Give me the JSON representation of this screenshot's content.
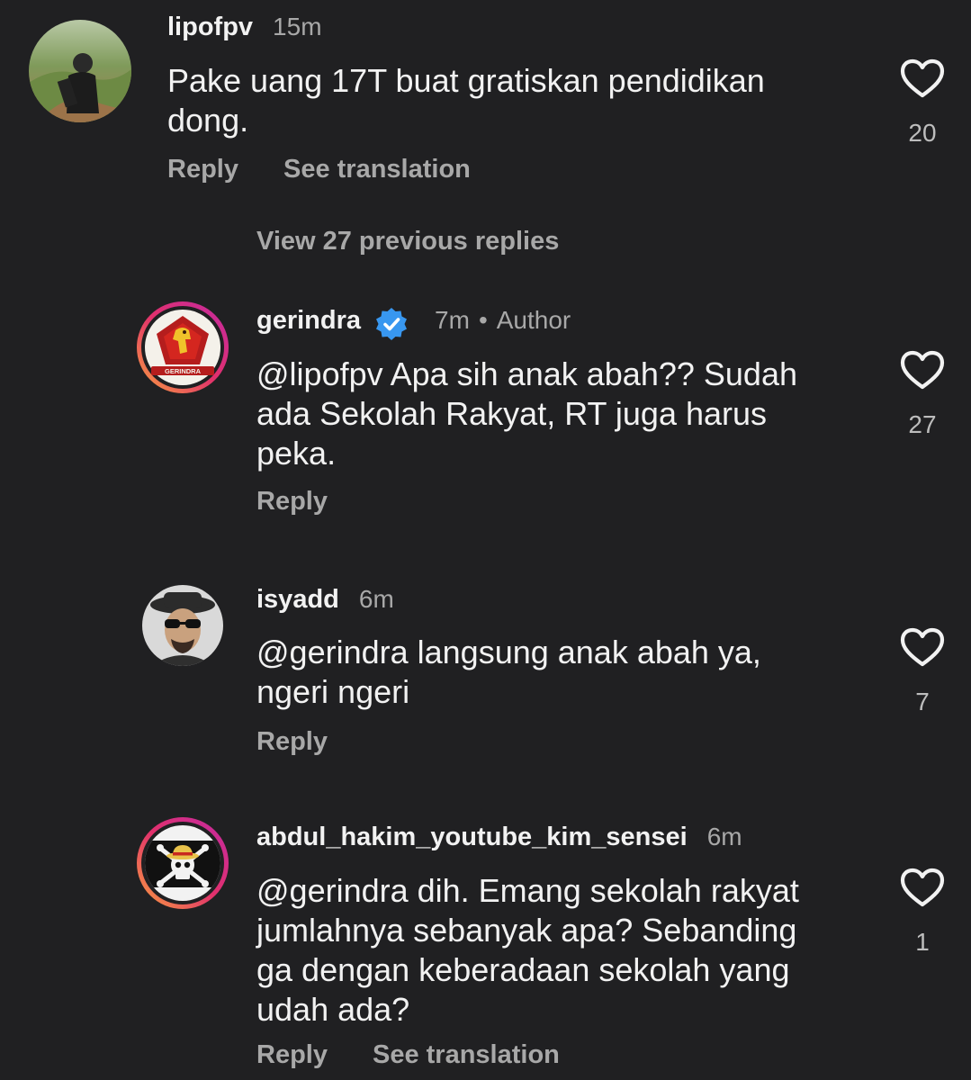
{
  "comments": [
    {
      "username": "lipofpv",
      "time": "15m",
      "body": "Pake uang 17T buat gratiskan pendidikan\ndong.",
      "reply_label": "Reply",
      "translate_label": "See translation",
      "likes": "20"
    },
    {
      "username": "gerindra",
      "verified": true,
      "time": "7m",
      "separator": "•",
      "author_label": "Author",
      "body": "@lipofpv Apa sih anak abah?? Sudah\nada Sekolah Rakyat, RT juga harus\npeka.",
      "reply_label": "Reply",
      "likes": "27",
      "logo_text": "GERINDRA"
    },
    {
      "username": "isyadd",
      "time": "6m",
      "body": "@gerindra langsung anak abah ya,\nngeri ngeri",
      "reply_label": "Reply",
      "likes": "7"
    },
    {
      "username": "abdul_hakim_youtube_kim_sensei",
      "time": "6m",
      "body": "@gerindra dih. Emang sekolah rakyat\njumlahnya sebanyak apa? Sebanding\nga dengan keberadaan sekolah yang\nudah ada?",
      "reply_label": "Reply",
      "translate_label": "See translation",
      "likes": "1"
    }
  ],
  "view_replies_label": "View 27 previous replies",
  "icons": {
    "like": "heart-outline-icon",
    "verified": "verified-badge-icon"
  },
  "colors": {
    "background": "#202022",
    "text_primary": "#f2f2f2",
    "text_secondary": "#a8a8a8",
    "verified_blue": "#3897f0",
    "story_ring_start": "#f9a03f",
    "story_ring_end": "#c32aa3"
  }
}
